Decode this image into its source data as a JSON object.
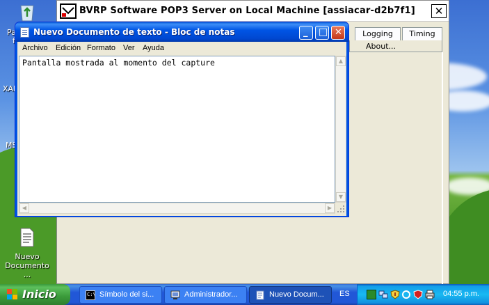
{
  "desktop": {
    "icons": [
      {
        "label_lines": [
          "Nuevo",
          "Documento ..."
        ]
      }
    ],
    "partial_labels": [
      "Pa",
      "f",
      "XAM",
      "MS"
    ]
  },
  "bvrp_window": {
    "title": "BVRP Software POP3 Server on Local Machine [assiacar-d2b7f1]",
    "close_glyph": "✕",
    "tabs": [
      "Logging",
      "Timing"
    ],
    "about_label": "About..."
  },
  "notepad": {
    "title": "Nuevo Documento de texto - Bloc de notas",
    "menu": [
      "Archivo",
      "Edición",
      "Formato",
      "Ver",
      "Ayuda"
    ],
    "content": "Pantalla mostrada al momento del capture",
    "buttons": {
      "minimize": "_",
      "maximize": "□",
      "close": "✕"
    }
  },
  "taskbar": {
    "start_label": "Inicio",
    "tasks": [
      {
        "label": "Símbolo del si...",
        "icon": "cmd-icon",
        "active": false
      },
      {
        "label": "Administrador...",
        "icon": "computer-icon",
        "active": false
      },
      {
        "label": "Nuevo Docum...",
        "icon": "notepad-icon",
        "active": true
      }
    ],
    "language": "ES",
    "tray_icons": [
      "green-square-icon",
      "network-icon",
      "shield-alert-icon",
      "refresh-icon",
      "antivirus-icon",
      "printer-icon"
    ],
    "clock": "04:55 p.m."
  }
}
